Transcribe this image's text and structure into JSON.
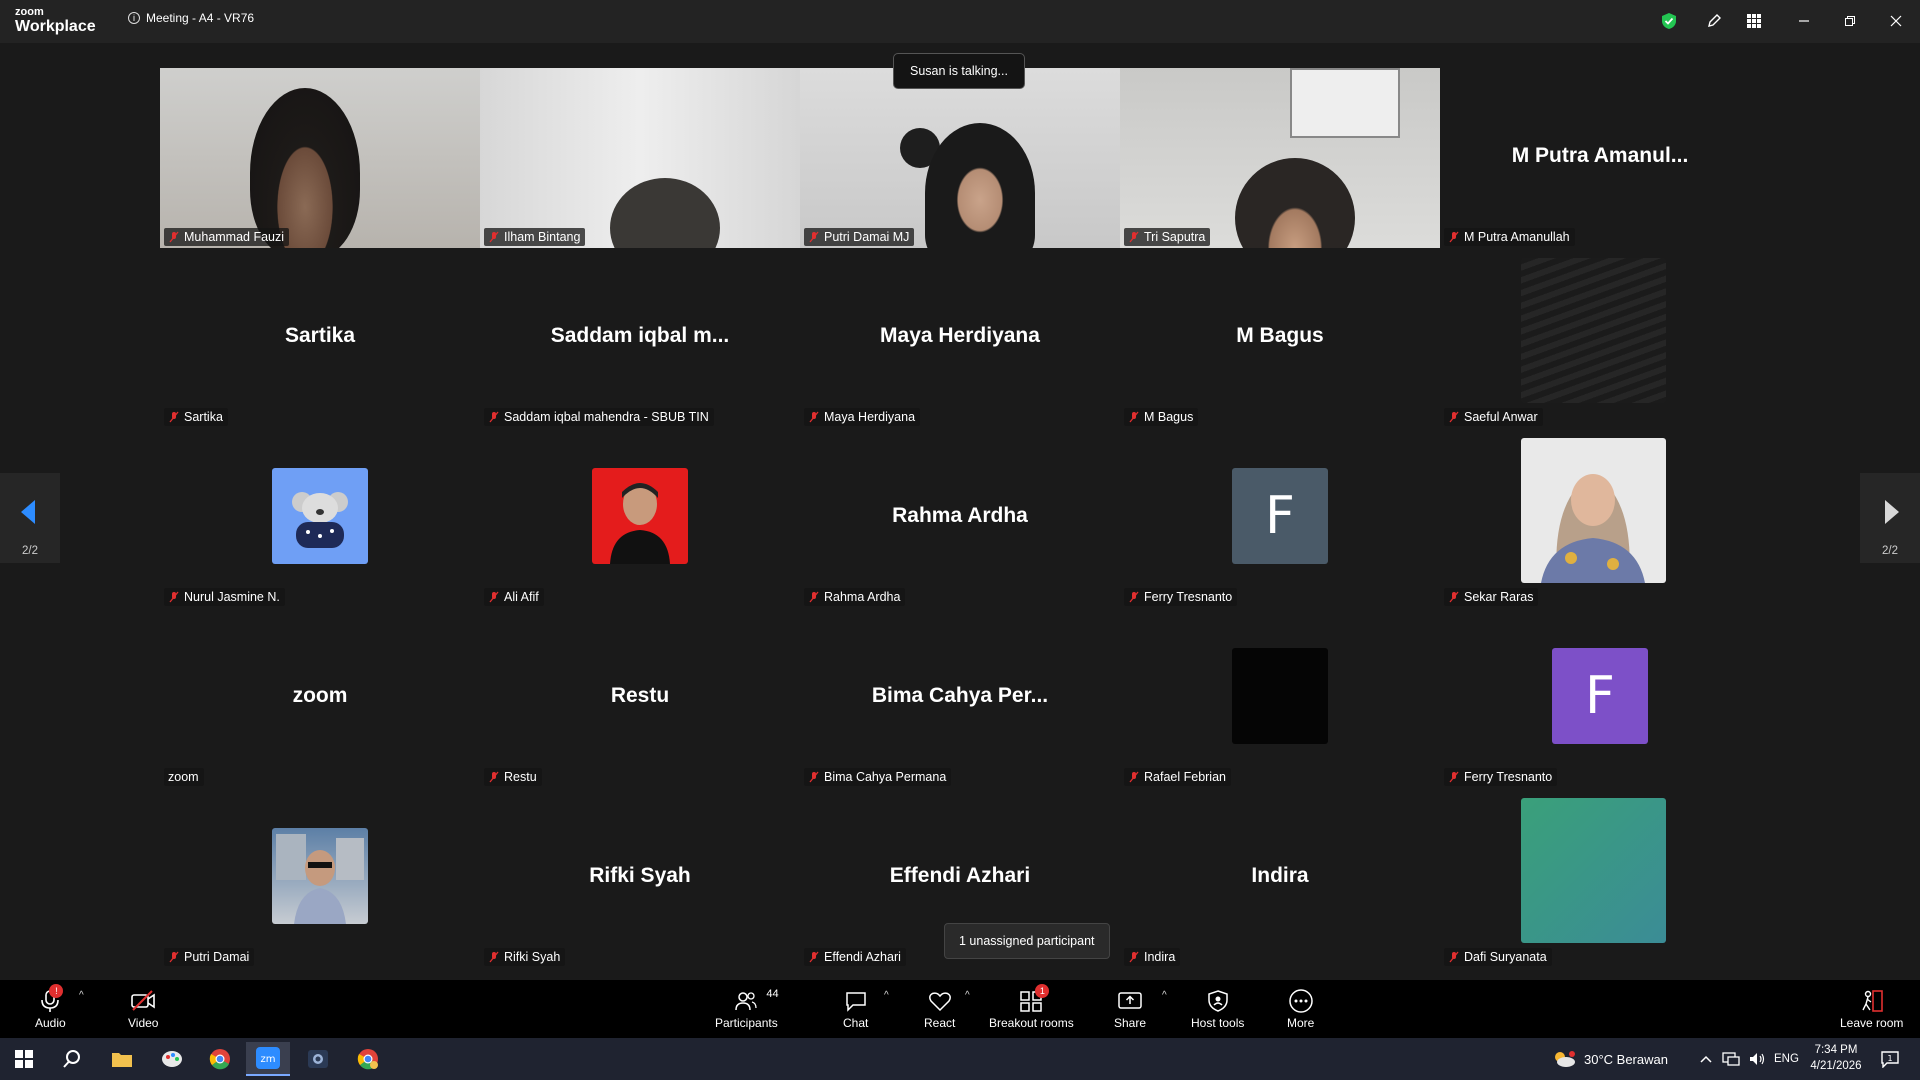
{
  "app": {
    "logo_line1": "zoom",
    "logo_line2": "Workplace",
    "meeting_title": "Meeting - A4 - VR76"
  },
  "colors": {
    "accent": "#2d8cff",
    "muted_red": "#e02f2f",
    "shield_green": "#23c552"
  },
  "talking_indicator": "Susan is talking...",
  "pager": {
    "page_left": "2/2",
    "page_right": "2/2"
  },
  "tiles": [
    {
      "name": "Muhammad Fauzi",
      "big": "",
      "kind": "video",
      "muted": true
    },
    {
      "name": "Ilham Bintang",
      "big": "",
      "kind": "video",
      "muted": true
    },
    {
      "name": "Putri Damai MJ",
      "big": "",
      "kind": "video",
      "muted": true
    },
    {
      "name": "Tri Saputra",
      "big": "",
      "kind": "video",
      "muted": true
    },
    {
      "name": "M Putra Amanullah",
      "big": "M Putra Amanul...",
      "kind": "name",
      "muted": true
    },
    {
      "name": "Sartika",
      "big": "Sartika",
      "kind": "name",
      "muted": true
    },
    {
      "name": "Saddam iqbal mahendra - SBUB TIN",
      "big": "Saddam iqbal m...",
      "kind": "name",
      "muted": true
    },
    {
      "name": "Maya Herdiyana",
      "big": "Maya Herdiyana",
      "kind": "name",
      "muted": true
    },
    {
      "name": "M Bagus",
      "big": "M Bagus",
      "kind": "name",
      "muted": true
    },
    {
      "name": "Saeful Anwar",
      "big": "",
      "kind": "photo-dark",
      "muted": true
    },
    {
      "name": "Nurul Jasmine N.",
      "big": "",
      "kind": "avatar-koala",
      "muted": true
    },
    {
      "name": "Ali Afif",
      "big": "",
      "kind": "avatar-red",
      "muted": true
    },
    {
      "name": "Rahma Ardha",
      "big": "Rahma Ardha",
      "kind": "name",
      "muted": true
    },
    {
      "name": "Ferry Tresnanto",
      "big": "F",
      "kind": "letter-gray",
      "muted": true
    },
    {
      "name": "Sekar Raras",
      "big": "",
      "kind": "photo-woman",
      "muted": true
    },
    {
      "name": "zoom",
      "big": "zoom",
      "kind": "name",
      "muted": false
    },
    {
      "name": "Restu",
      "big": "Restu",
      "kind": "name",
      "muted": true
    },
    {
      "name": "Bima Cahya Permana",
      "big": "Bima Cahya Per...",
      "kind": "name",
      "muted": true
    },
    {
      "name": "Rafael Febrian",
      "big": "",
      "kind": "avatar-black",
      "muted": true
    },
    {
      "name": "Ferry Tresnanto",
      "big": "F",
      "kind": "letter-purple",
      "muted": true
    },
    {
      "name": "Putri Damai",
      "big": "",
      "kind": "avatar-photo",
      "muted": true
    },
    {
      "name": "Rifki Syah",
      "big": "Rifki Syah",
      "kind": "name",
      "muted": true
    },
    {
      "name": "Effendi Azhari",
      "big": "Effendi Azhari",
      "kind": "name",
      "muted": true
    },
    {
      "name": "Indira",
      "big": "Indira",
      "kind": "name",
      "muted": true
    },
    {
      "name": "Dafi Suryanata",
      "big": "",
      "kind": "photo-teal",
      "muted": true
    }
  ],
  "unassigned_tooltip": "1 unassigned participant",
  "toolbar": {
    "audio": "Audio",
    "video": "Video",
    "participants": "Participants",
    "participants_count": "44",
    "chat": "Chat",
    "react": "React",
    "breakout": "Breakout rooms",
    "breakout_badge": "1",
    "share": "Share",
    "host_tools": "Host tools",
    "more": "More",
    "leave": "Leave room"
  },
  "taskbar": {
    "weather": "30°C  Berawan",
    "lang": "ENG",
    "time": "7:34 PM",
    "date": "4/21/2026"
  }
}
